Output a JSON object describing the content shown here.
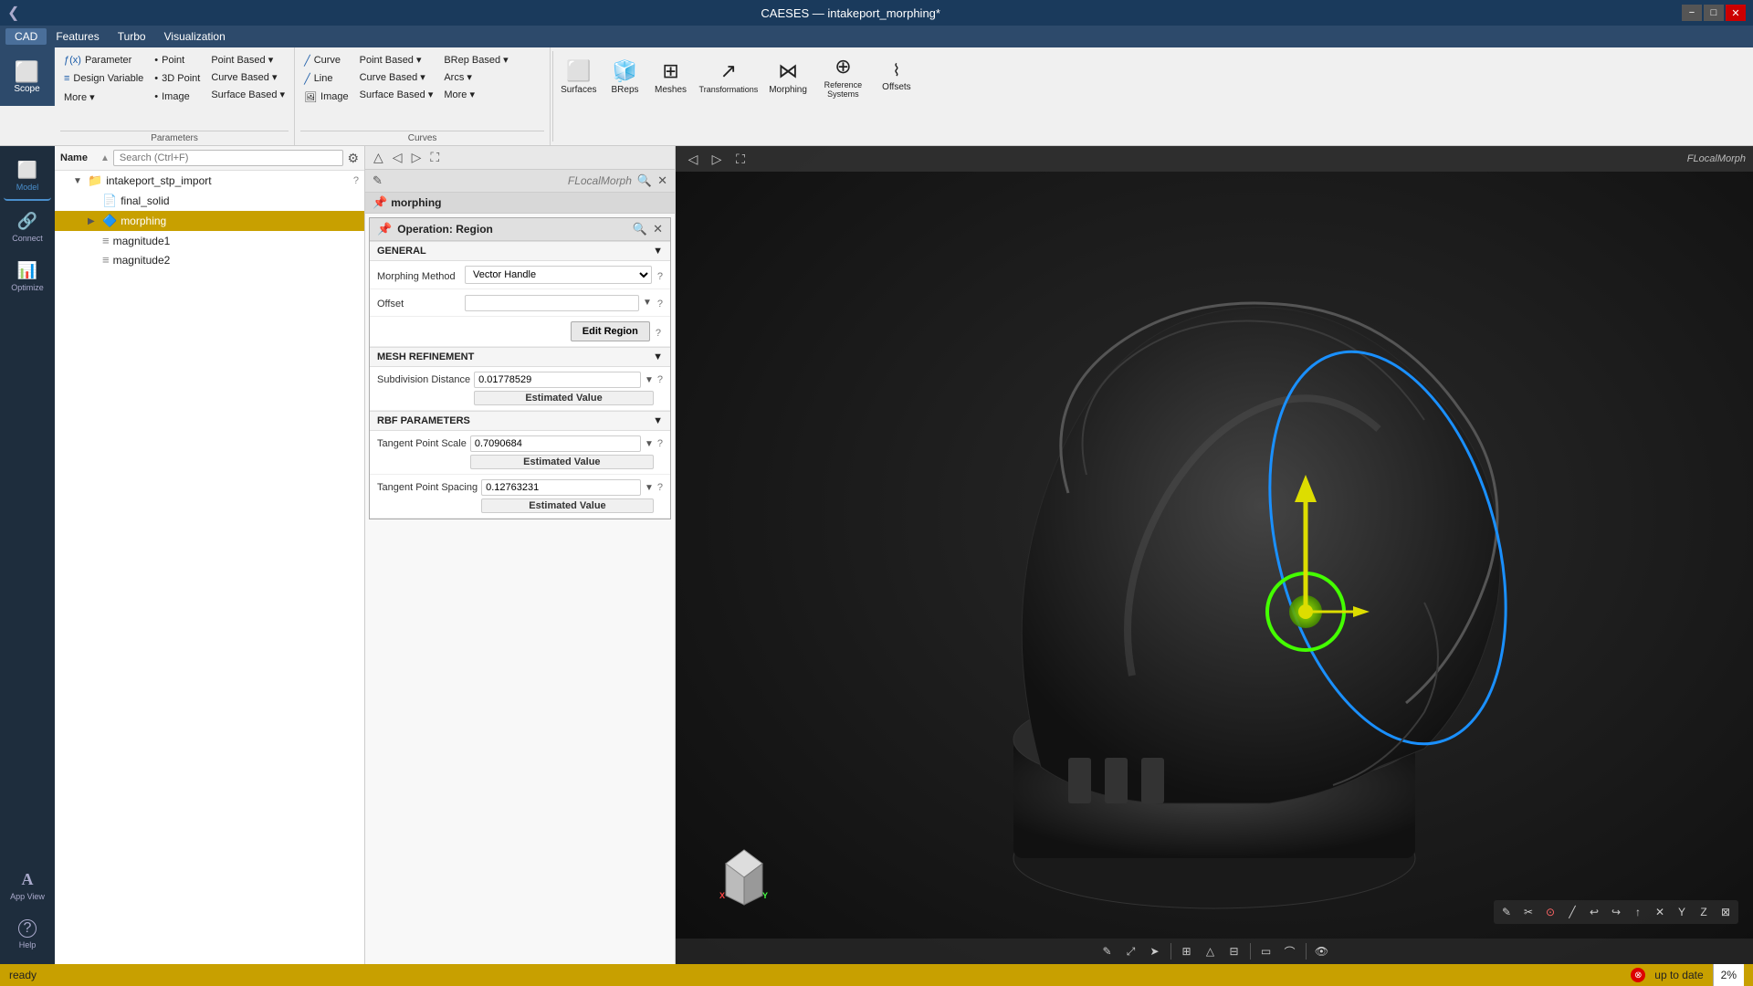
{
  "app": {
    "title": "CAESES — intakeport_morphing*",
    "titlebar_nav": "❮"
  },
  "menu": {
    "items": [
      "CAD",
      "Features",
      "Turbo",
      "Visualization"
    ]
  },
  "ribbon": {
    "scope_label": "Scope",
    "groups": [
      {
        "name": "Parameters",
        "items_col1": [
          {
            "label": "Parameter",
            "icon": "ƒ(x)",
            "type": "small"
          },
          {
            "label": "Design Variable",
            "icon": "≡",
            "type": "small"
          },
          {
            "label": "More ▾",
            "type": "small"
          }
        ],
        "items_col2": [
          {
            "label": "Point",
            "type": "small"
          },
          {
            "label": "3D Point",
            "type": "small"
          },
          {
            "label": "Image",
            "type": "small"
          }
        ],
        "items_col3": [
          {
            "label": "Point Based ▾",
            "type": "dropdown"
          },
          {
            "label": "Curve Based ▾",
            "type": "dropdown"
          },
          {
            "label": "Surface Based ▾",
            "type": "dropdown"
          }
        ]
      },
      {
        "name": "Curves",
        "items_col1": [
          {
            "label": "Curve",
            "icon": "╱",
            "type": "small"
          },
          {
            "label": "Line",
            "icon": "╱",
            "type": "small"
          },
          {
            "label": "Image",
            "icon": "🖼",
            "type": "small"
          }
        ],
        "items_col2": [
          {
            "label": "Point Based ▾",
            "type": "dropdown"
          },
          {
            "label": "Curve Based ▾",
            "type": "dropdown"
          },
          {
            "label": "Surface Based ▾",
            "type": "dropdown"
          }
        ],
        "items_col3": [
          {
            "label": "BRep Based ▾",
            "type": "dropdown"
          },
          {
            "label": "Arcs ▾",
            "type": "dropdown"
          },
          {
            "label": "More ▾",
            "type": "dropdown"
          }
        ]
      }
    ],
    "large_buttons": [
      {
        "label": "Surfaces",
        "icon": "⬜"
      },
      {
        "label": "BReps",
        "icon": "🧊"
      },
      {
        "label": "Meshes",
        "icon": "⊞"
      },
      {
        "label": "Transformations",
        "icon": "↗"
      },
      {
        "label": "Morphing",
        "icon": "⋈"
      },
      {
        "label": "Reference Systems",
        "icon": "⊕"
      },
      {
        "label": "Offsets",
        "icon": "⌇"
      }
    ]
  },
  "tree": {
    "search_placeholder": "Search (Ctrl+F)",
    "col_name": "Name",
    "items": [
      {
        "id": "root",
        "label": "intakeport_stp_import",
        "icon": "📁",
        "indent": 1,
        "expanded": true
      },
      {
        "id": "final_solid",
        "label": "final_solid",
        "icon": "📄",
        "indent": 2
      },
      {
        "id": "morphing",
        "label": "morphing",
        "icon": "🔷",
        "indent": 2,
        "selected": true
      },
      {
        "id": "magnitude1",
        "label": "magnitude1",
        "icon": "≡",
        "indent": 2
      },
      {
        "id": "magnitude2",
        "label": "magnitude2",
        "icon": "≡",
        "indent": 2
      }
    ]
  },
  "viewport_panel": {
    "flocal_label": "FLocalMorph",
    "morphing_label": "morphing",
    "toolbar_nav": [
      "◁",
      "▷",
      "⛶"
    ],
    "edit_icon": "✎",
    "search_icon": "🔍",
    "close_icon": "✕"
  },
  "operation": {
    "title": "Operation: Region",
    "search_icon": "🔍",
    "close_icon": "✕",
    "pin_icon": "📌",
    "sections": [
      {
        "id": "general",
        "label": "GENERAL",
        "fields": [
          {
            "id": "morphing_method",
            "label": "Morphing Method",
            "value": "Vector Handle",
            "type": "select",
            "help": "?"
          },
          {
            "id": "offset",
            "label": "Offset",
            "value": "",
            "type": "input",
            "help": "?"
          },
          {
            "id": "edit_region",
            "label": "",
            "value": "Edit Region",
            "type": "button",
            "help": "?"
          }
        ]
      },
      {
        "id": "mesh_refinement",
        "label": "MESH REFINEMENT",
        "fields": [
          {
            "id": "subdivision_distance",
            "label": "Subdivision Distance",
            "value": "0.01778529",
            "type": "input",
            "estimated": "Estimated Value",
            "help": "?"
          }
        ]
      },
      {
        "id": "rbf_parameters",
        "label": "RBF PARAMETERS",
        "fields": [
          {
            "id": "tangent_point_scale",
            "label": "Tangent Point Scale",
            "value": "0.7090684",
            "type": "input",
            "estimated": "Estimated Value",
            "help": "?"
          },
          {
            "id": "tangent_point_spacing",
            "label": "Tangent Point Spacing",
            "value": "0.12763231",
            "type": "input",
            "estimated": "Estimated Value",
            "help": "?"
          }
        ]
      }
    ]
  },
  "statusbar": {
    "status": "ready",
    "uptodate": "up to date",
    "zoom": "2%"
  },
  "sidebar_nav": {
    "items": [
      {
        "id": "model",
        "label": "Model",
        "icon": "⬜"
      },
      {
        "id": "connect",
        "label": "Connect",
        "icon": "🔗"
      },
      {
        "id": "optimize",
        "label": "Optimize",
        "icon": "📊"
      },
      {
        "id": "appview",
        "label": "App View",
        "icon": "A"
      },
      {
        "id": "help",
        "label": "Help",
        "icon": "?"
      }
    ]
  }
}
